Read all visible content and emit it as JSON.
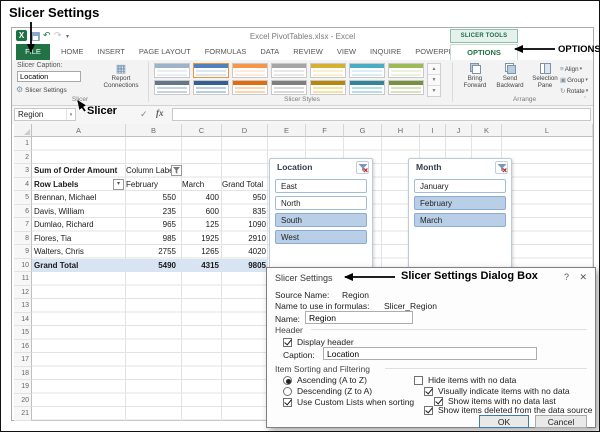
{
  "annotations": {
    "page_title": "Slicer Settings",
    "options_callout": "OPTIONS",
    "slicer_callout": "Slicer",
    "dialog_callout": "Slicer Settings Dialog Box"
  },
  "window": {
    "title": "Excel PivotTables.xlsx - Excel"
  },
  "ribbon": {
    "file_tab": "FILE",
    "tabs": [
      "HOME",
      "INSERT",
      "PAGE LAYOUT",
      "FORMULAS",
      "DATA",
      "REVIEW",
      "VIEW",
      "INQUIRE",
      "POWERPIVOT"
    ],
    "contextual_header": "SLICER TOOLS",
    "contextual_tab": "OPTIONS",
    "slicer_group": {
      "caption_label": "Slicer Caption:",
      "caption_value": "Location",
      "settings_button": "Slicer Settings",
      "report_connections_line1": "Report",
      "report_connections_line2": "Connections",
      "group_name": "Slicer"
    },
    "styles_group": {
      "group_name": "Slicer Styles"
    },
    "arrange_group": {
      "bring_forward": "Bring Forward",
      "send_backward": "Send Backward",
      "selection_pane": "Selection Pane",
      "align": "Align",
      "group": "Group",
      "rotate": "Rotate",
      "group_name": "Arrange"
    }
  },
  "formula_bar": {
    "name_box_value": "Region",
    "fx_label": "fx"
  },
  "sheet": {
    "columns": [
      "A",
      "B",
      "C",
      "D",
      "E",
      "F",
      "G",
      "H",
      "I",
      "J",
      "K",
      "L"
    ],
    "row_numbers": [
      "1",
      "2",
      "3",
      "4",
      "5",
      "6",
      "7",
      "8",
      "9",
      "10",
      "11",
      "12",
      "13",
      "14",
      "15",
      "16",
      "17",
      "18",
      "19",
      "20",
      "21"
    ],
    "pivot": {
      "title_cell": "Sum of Order Amount",
      "column_labels": "Column Labels",
      "row_labels": "Row Labels",
      "col_headers": [
        "February",
        "March",
        "Grand Total"
      ],
      "rows": [
        {
          "name": "Brennan, Michael",
          "february": "550",
          "march": "400",
          "total": "950"
        },
        {
          "name": "Davis, William",
          "february": "235",
          "march": "600",
          "total": "835"
        },
        {
          "name": "Dumlao, Richard",
          "february": "965",
          "march": "125",
          "total": "1090"
        },
        {
          "name": "Flores, Tia",
          "february": "985",
          "march": "1925",
          "total": "2910"
        },
        {
          "name": "Walters, Chris",
          "february": "2755",
          "march": "1265",
          "total": "4020"
        }
      ],
      "grand_total": {
        "name": "Grand Total",
        "february": "5490",
        "march": "4315",
        "total": "9805"
      }
    }
  },
  "slicers": {
    "location": {
      "title": "Location",
      "items": [
        {
          "label": "East",
          "selected": false
        },
        {
          "label": "North",
          "selected": false
        },
        {
          "label": "South",
          "selected": true
        },
        {
          "label": "West",
          "selected": true
        }
      ]
    },
    "month": {
      "title": "Month",
      "items": [
        {
          "label": "January",
          "selected": false
        },
        {
          "label": "February",
          "selected": true
        },
        {
          "label": "March",
          "selected": true
        }
      ]
    }
  },
  "dialog": {
    "title": "Slicer Settings",
    "help": "?",
    "close": "✕",
    "source_name_label": "Source Name:",
    "source_name_value": "Region",
    "formula_name_label": "Name to use in formulas:",
    "formula_name_value": "Slicer_Region",
    "name_label": "Name:",
    "name_value": "Region",
    "header_section": "Header",
    "display_header": {
      "label": "Display header",
      "checked": true
    },
    "caption_label": "Caption:",
    "caption_value": "Location",
    "sorting_section": "Item Sorting and Filtering",
    "ascending": {
      "label": "Ascending (A to Z)",
      "selected": true
    },
    "descending": {
      "label": "Descending (Z to A)",
      "selected": false
    },
    "use_custom_lists": {
      "label": "Use Custom Lists when sorting",
      "checked": true
    },
    "hide_items": {
      "label": "Hide items with no data",
      "checked": false
    },
    "visually_indicate": {
      "label": "Visually indicate items with no data",
      "checked": true
    },
    "show_no_data_last": {
      "label": "Show items with no data last",
      "checked": true
    },
    "show_deleted": {
      "label": "Show items deleted from the data source",
      "checked": true
    },
    "ok_button": "OK",
    "cancel_button": "Cancel"
  },
  "colors": {
    "excel_green": "#217346",
    "slicer_selected": "#b9cfe7",
    "grand_total_highlight": "#d9e4f2"
  }
}
